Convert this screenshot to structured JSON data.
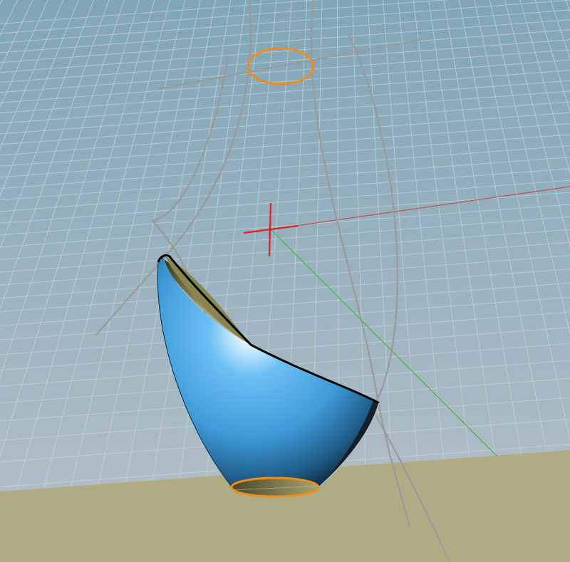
{
  "viewport": {
    "view": "perspective",
    "background_top_color": "#7fa6b7",
    "background_bottom_color": "#b7c0c8",
    "grid_line_color": "#c9d4da",
    "ground_color": "#b0ab82",
    "ground_highlight_color": "#b8b38a"
  },
  "axes": {
    "x_color": "#c84a4a",
    "y_color": "#4ab04a",
    "cursor_color": "#e51d1d"
  },
  "construction_curves": {
    "color": "#9a9a9a",
    "count": 6
  },
  "profile_circles": {
    "color": "#f08c1c",
    "count": 2,
    "selected": true
  },
  "surface": {
    "type": "lofted bowl surface",
    "outer_color": "#4aa8e8",
    "highlight_color": "#ffffff",
    "inner_color": "#8a8450",
    "edge_color": "#000000"
  }
}
